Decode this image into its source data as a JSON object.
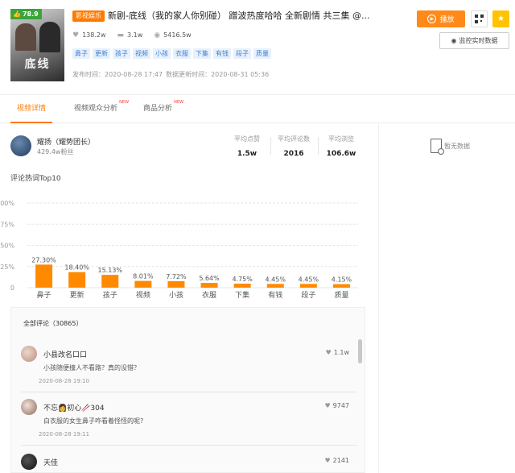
{
  "header": {
    "score": "78.9",
    "thumb_title": "底线",
    "category": "影视娱乐",
    "title": "新剧-底线（我的家人你别碰） 蹭波热度哈哈 全新剧情 共三集 @...",
    "stats": {
      "likes": "138.2w",
      "comments": "3.1w",
      "views": "5416.5w"
    },
    "tags": [
      "鼻子",
      "更新",
      "孩子",
      "视频",
      "小孩",
      "衣服",
      "下集",
      "有钱",
      "段子",
      "质量"
    ],
    "publish_time": "发布时间：2020-08-28 17:47",
    "update_time": "数据更新时间：2020-08-31 05:36",
    "play_label": "播放",
    "monitor_label": "监控实时数据"
  },
  "tabs": [
    {
      "label": "视频详情",
      "new": ""
    },
    {
      "label": "视频观众分析",
      "new": "NEW"
    },
    {
      "label": "商品分析",
      "new": "NEW"
    }
  ],
  "author": {
    "name": "耀扬（耀势团长）",
    "fans": "429.4w粉丝",
    "metrics": [
      {
        "label": "平均点赞",
        "value": "1.5w"
      },
      {
        "label": "平均评论数",
        "value": "2016"
      },
      {
        "label": "平均浏览",
        "value": "106.6w"
      }
    ]
  },
  "right_panel": {
    "no_data": "暂无数据"
  },
  "word_section_title": "评论热词Top10",
  "chart_data": {
    "type": "bar",
    "categories": [
      "鼻子",
      "更新",
      "孩子",
      "视频",
      "小孩",
      "衣服",
      "下集",
      "有钱",
      "段子",
      "质量"
    ],
    "values": [
      27.3,
      18.4,
      15.13,
      8.01,
      7.72,
      5.64,
      4.75,
      4.45,
      4.45,
      4.15
    ],
    "value_labels": [
      "27.30%",
      "18.40%",
      "15.13%",
      "8.01%",
      "7.72%",
      "5.64%",
      "4.75%",
      "4.45%",
      "4.45%",
      "4.15%"
    ],
    "ylim": [
      0,
      100
    ],
    "yticks": [
      "0",
      "25%",
      "50%",
      "75%",
      "100%"
    ],
    "bar_color": "#ff8a00",
    "grid": true
  },
  "comments": {
    "header": "全部评论（30865）",
    "items": [
      {
        "name": "小县改名口口",
        "text": "小孩随便撞人不看路？真的没错？",
        "date": "2020-08-28 19:10",
        "likes": "1.1w"
      },
      {
        "name": "不忘👩初心🥢304",
        "text": "白衣服的女生鼻子咋看着怪怪的呢?",
        "date": "2020-08-28 19:11",
        "likes": "9747"
      },
      {
        "name": "天佳",
        "text": "",
        "date": "",
        "likes": "2141"
      }
    ]
  },
  "colors": {
    "accent": "#ff7a00",
    "tag_bg": "#e8f1fc",
    "tag_text": "#3d7fd4",
    "score_bg": "#3aa53a"
  }
}
